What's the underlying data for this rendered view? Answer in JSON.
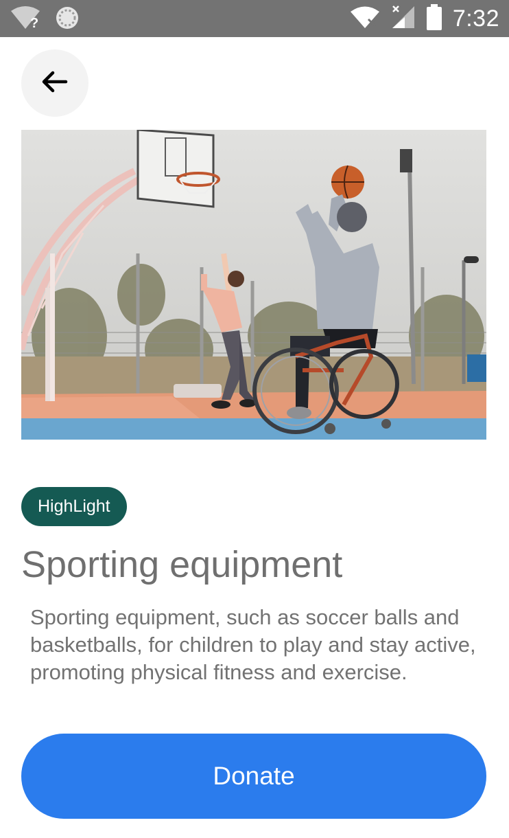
{
  "status_bar": {
    "time": "7:32",
    "icons": [
      "wifi-question-icon",
      "sync-icon",
      "wifi-x-icon",
      "signal-x-icon",
      "battery-icon"
    ]
  },
  "back_button": {
    "icon": "arrow-left-icon"
  },
  "hero_image": {
    "subject": "basketball-court-photo"
  },
  "badge": {
    "label": "HighLight"
  },
  "title": "Sporting equipment",
  "description": "Sporting equipment, such as soccer balls and basketballs, for children to play and stay active, promoting physical fitness and exercise.",
  "donate_button": {
    "label": "Donate"
  },
  "colors": {
    "status_bar": "#737373",
    "badge": "#155a53",
    "donate": "#2b7ced",
    "title_text": "#6f6f6f",
    "body_text": "#727272"
  }
}
